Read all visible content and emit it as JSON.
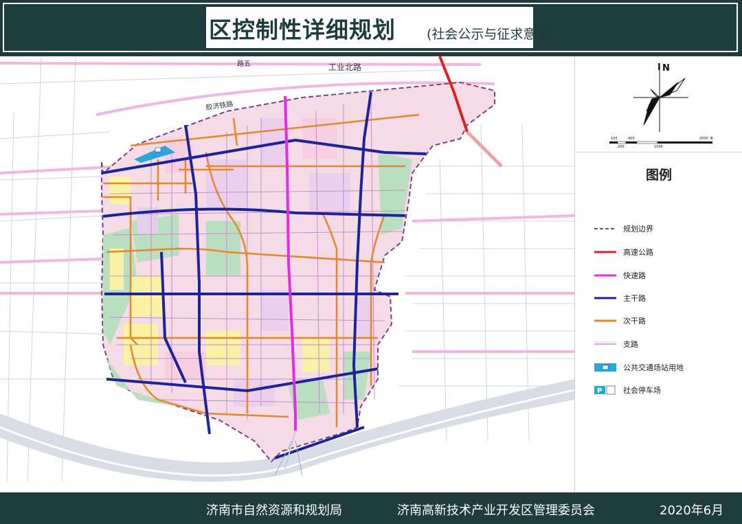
{
  "header": {
    "title": "区控制性详细规划",
    "subtitle": "(社会公示与征求意见)"
  },
  "map": {
    "labels": {
      "gongye_north_road": "工业北路",
      "jiaoji_railway": "胶济铁路",
      "road_top_left": "路五"
    }
  },
  "compass": {
    "north": "N",
    "scale_ticks": [
      "100",
      "400",
      "200",
      "1000",
      "2000",
      "米"
    ]
  },
  "legend": {
    "title": "图例",
    "items": [
      {
        "label": "规划边界",
        "color": "#7b3f8a"
      },
      {
        "label": "高速公路",
        "color": "#e01f1f"
      },
      {
        "label": "快速路",
        "color": "#e12ee0"
      },
      {
        "label": "主干路",
        "color": "#1d239a"
      },
      {
        "label": "次干路",
        "color": "#e4882a"
      },
      {
        "label": "支路",
        "color": "#c88ccc"
      },
      {
        "label": "公共交通场站用地",
        "color": "#2aa6d8"
      },
      {
        "label": "社会停车场",
        "color": "#2aa6d8"
      }
    ]
  },
  "footer": {
    "org1": "济南市自然资源和规划局",
    "org2": "济南高新技术产业开发区管理委员会",
    "date": "2020年6月"
  }
}
